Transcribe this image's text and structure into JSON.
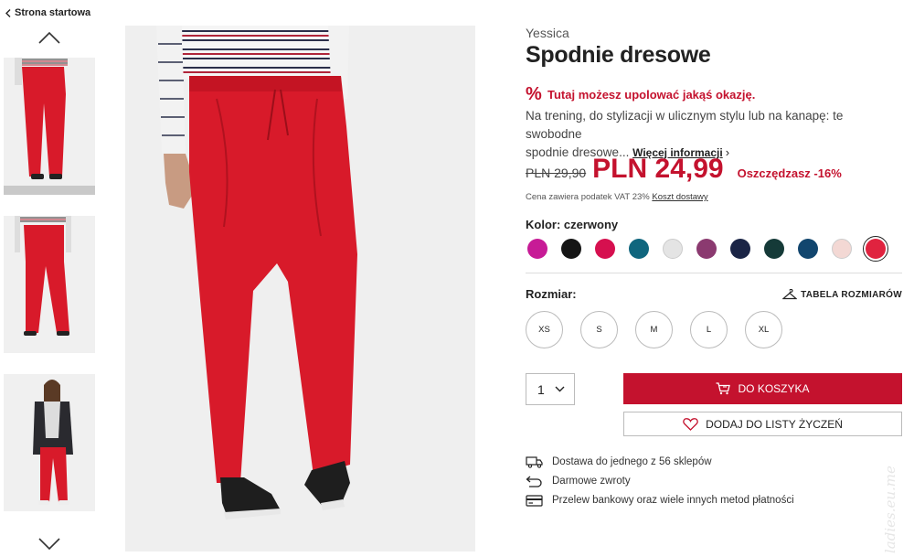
{
  "nav": {
    "back_label": "Strona startowa"
  },
  "product": {
    "brand": "Yessica",
    "title": "Spodnie dresowe",
    "promo_icon": "%",
    "promo_text": "Tutaj możesz upolować jakąś okazję.",
    "description_line1": "Na trening, do stylizacji w ulicznym stylu lub na kanapę: te swobodne",
    "description_line2": "spodnie dresowe...",
    "more_info_label": "Więcej informacji",
    "old_price": "PLN 29,90",
    "new_price": "PLN 24,99",
    "saving": "Oszczędzasz -16%",
    "vat_text": "Cena zawiera podatek VAT 23%",
    "shipping_link": "Koszt dostawy"
  },
  "color": {
    "label": "Kolor: czerwony",
    "swatches": [
      "#c71b96",
      "#151515",
      "#d6104f",
      "#10667e",
      "#e4e4e4",
      "#8b3a70",
      "#1b2546",
      "#153a38",
      "#12466e",
      "#f3d8d4",
      "#e0233f"
    ],
    "selected_index": 10
  },
  "size": {
    "label": "Rozmiar:",
    "table_label": "TABELA ROZMIARÓW",
    "options": [
      "XS",
      "S",
      "M",
      "L",
      "XL"
    ]
  },
  "purchase": {
    "quantity": "1",
    "cart_label": "DO KOSZYKA",
    "wishlist_label": "DODAJ DO LISTY ŻYCZEŃ"
  },
  "info": [
    {
      "icon": "truck-icon",
      "text": "Dostawa do jednego z 56 sklepów"
    },
    {
      "icon": "return-icon",
      "text": "Darmowe zwroty"
    },
    {
      "icon": "card-icon",
      "text": "Przelew bankowy oraz wiele innych metod płatności"
    }
  ],
  "watermark": "ladies.eu.me"
}
